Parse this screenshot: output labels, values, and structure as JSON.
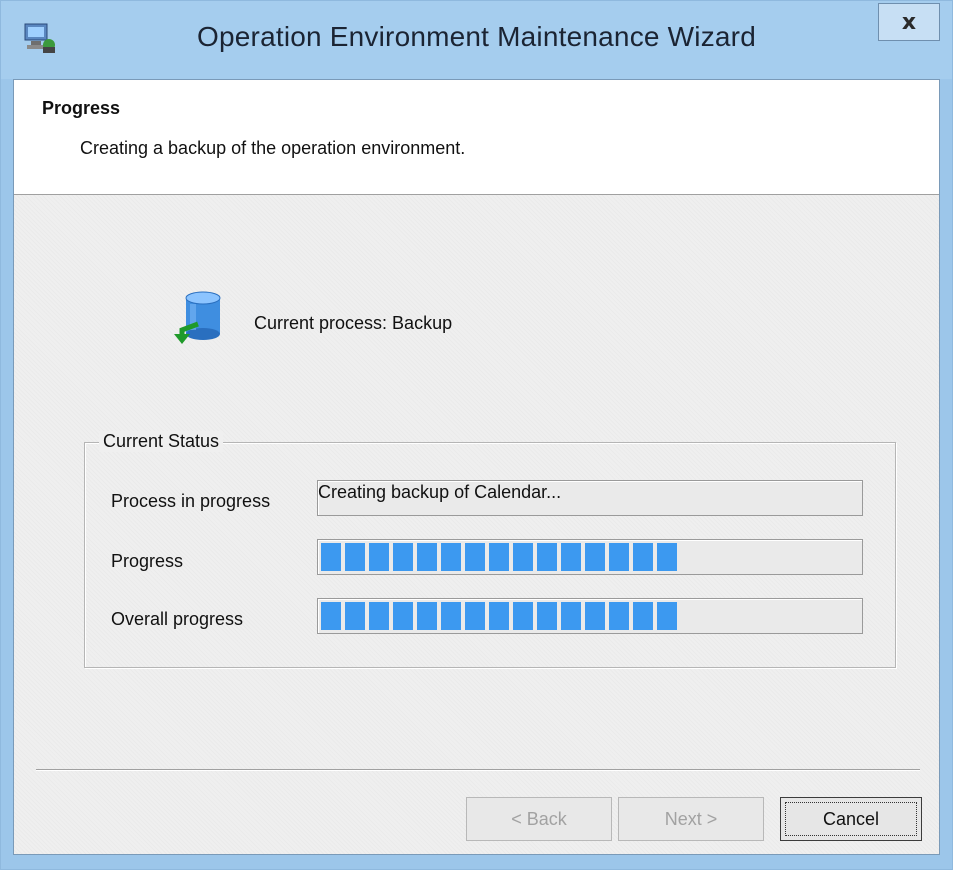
{
  "window": {
    "title": "Operation Environment Maintenance Wizard",
    "close_label": "x",
    "app_icon": "computer-wizard-icon"
  },
  "header": {
    "title": "Progress",
    "description": "Creating a backup of the operation environment."
  },
  "process": {
    "icon": "database-backup-icon",
    "label": "Current process: Backup"
  },
  "status": {
    "group_title": "Current Status",
    "process_label": "Process in progress",
    "process_value": "Creating backup of Calendar...",
    "progress_label": "Progress",
    "progress_fraction": 0.66,
    "overall_label": "Overall progress",
    "overall_fraction": 0.66,
    "bar_color": "#3c99f0"
  },
  "buttons": {
    "back": "< Back",
    "next": "Next >",
    "cancel": "Cancel"
  }
}
